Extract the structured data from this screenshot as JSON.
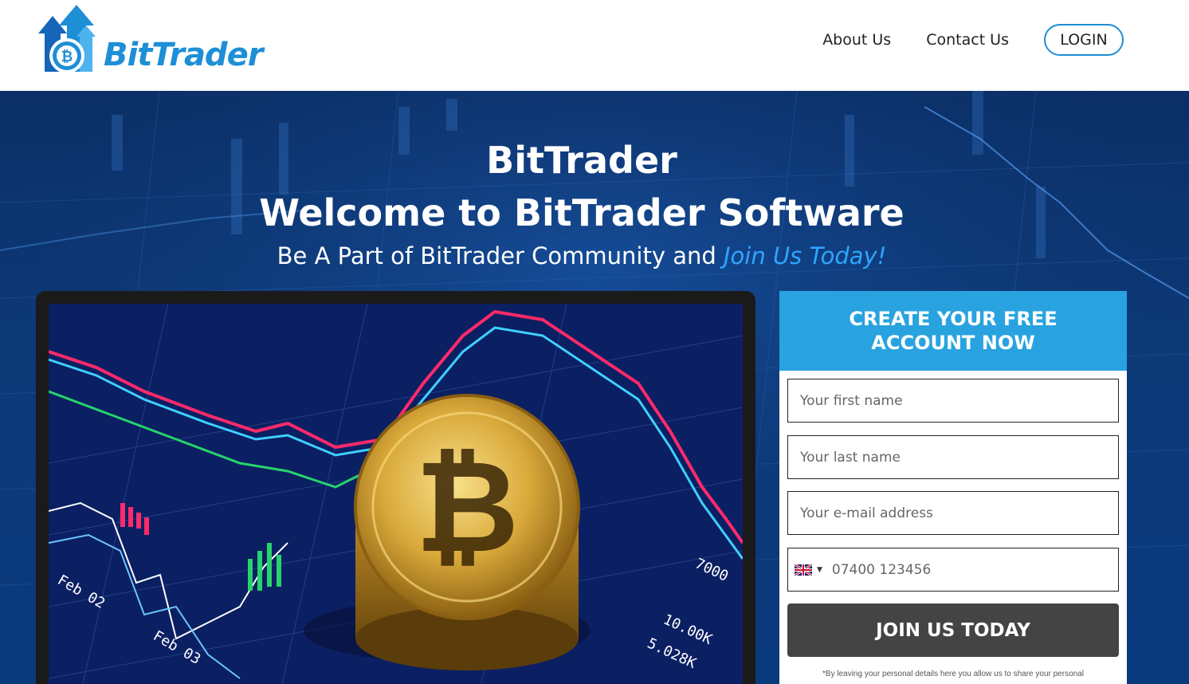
{
  "brand": {
    "name": "BitTrader",
    "accent_color": "#1e8fd6"
  },
  "nav": {
    "about": "About Us",
    "contact": "Contact Us",
    "login": "LOGIN"
  },
  "hero": {
    "title": "BitTrader",
    "subtitle": "Welcome to BitTrader Software",
    "tagline_prefix": "Be A Part of BitTrader Community and ",
    "tagline_accent": "Join Us Today!",
    "accent_color": "#2ea6ff"
  },
  "photo": {
    "labels": [
      "Feb 02",
      "Feb 03",
      "7000",
      "10.00K",
      "5.028K"
    ]
  },
  "form": {
    "heading_line1": "CREATE YOUR FREE",
    "heading_line2": "ACCOUNT NOW",
    "first_name_placeholder": "Your first name",
    "last_name_placeholder": "Your last name",
    "email_placeholder": "Your e-mail address",
    "phone_placeholder": "07400 123456",
    "flag_icon": "uk-flag-icon",
    "submit_label": "JOIN US TODAY",
    "disclaimer": "*By leaving your personal details here you allow us to share your personal"
  }
}
